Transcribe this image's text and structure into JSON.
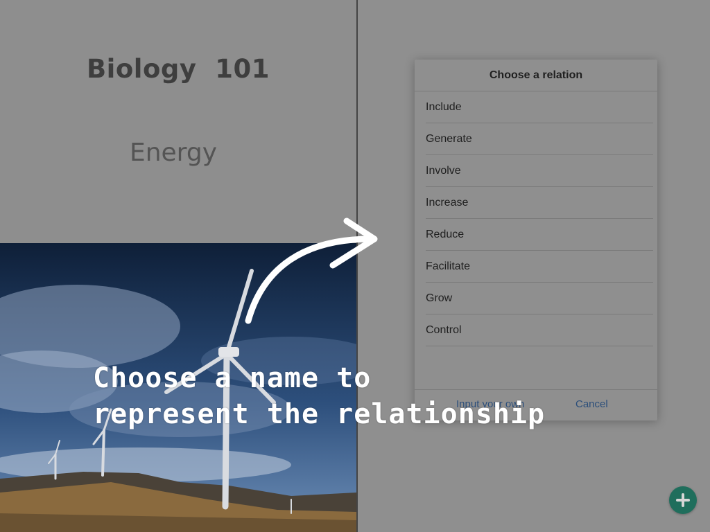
{
  "header": {
    "course": "Biology  101",
    "topic": "Energy"
  },
  "relation_dialog": {
    "title": "Choose a relation",
    "options": [
      "Include",
      "Generate",
      "Involve",
      "Increase",
      "Reduce",
      "Facilitate",
      "Grow",
      "Control"
    ],
    "footer_left": "Input your own",
    "footer_right": "Cancel"
  },
  "hint": {
    "line1": "Choose a name to",
    "line2": "represent the relationship"
  },
  "icons": {
    "add": "plus-icon",
    "arrow": "curved-arrow-icon"
  },
  "colors": {
    "fab": "#1f6e5c",
    "link": "#2b4e7a",
    "overlay": "#8f8f8f"
  }
}
